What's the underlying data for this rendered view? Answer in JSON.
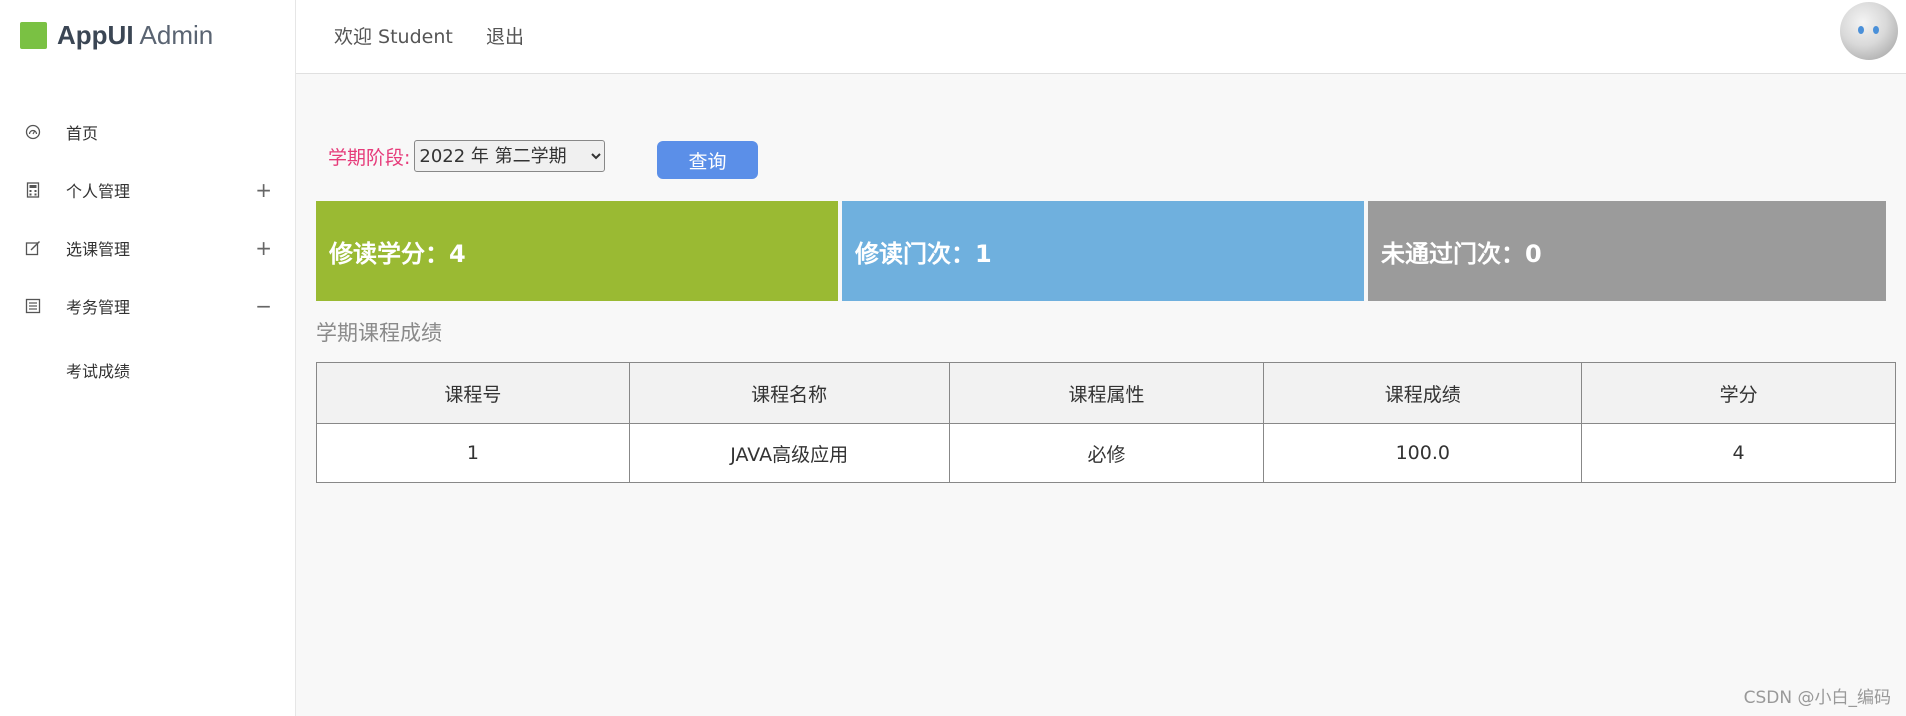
{
  "brand": {
    "strong": "AppUI",
    "light": "Admin",
    "logo_color": "#7ac143"
  },
  "header": {
    "welcome": "欢迎 Student",
    "logout": "退出"
  },
  "sidebar": {
    "items": [
      {
        "label": "首页",
        "icon": "dashboard-icon",
        "toggle": ""
      },
      {
        "label": "个人管理",
        "icon": "calculator-icon",
        "toggle": "+"
      },
      {
        "label": "选课管理",
        "icon": "edit-icon",
        "toggle": "+"
      },
      {
        "label": "考务管理",
        "icon": "list-icon",
        "toggle": "−"
      }
    ],
    "subitems": [
      {
        "label": "考试成绩"
      }
    ]
  },
  "filter": {
    "label": "学期阶段:",
    "selected": "2022 年 第二学期",
    "query_label": "查询"
  },
  "stats": [
    {
      "label": "修读学分：4",
      "color": "#9aba33"
    },
    {
      "label": "修读门次：1",
      "color": "#6fb0de"
    },
    {
      "label": "未通过门次：0",
      "color": "#9b9b9b"
    }
  ],
  "section_title": "学期课程成绩",
  "table": {
    "headers": [
      "课程号",
      "课程名称",
      "课程属性",
      "课程成绩",
      "学分"
    ],
    "rows": [
      [
        "1",
        "JAVA高级应用",
        "必修",
        "100.0",
        "4"
      ]
    ]
  },
  "watermark": "CSDN @小白_编码",
  "colors": {
    "accent_button": "#5b8fe8",
    "filter_label": "#e63b7a"
  }
}
